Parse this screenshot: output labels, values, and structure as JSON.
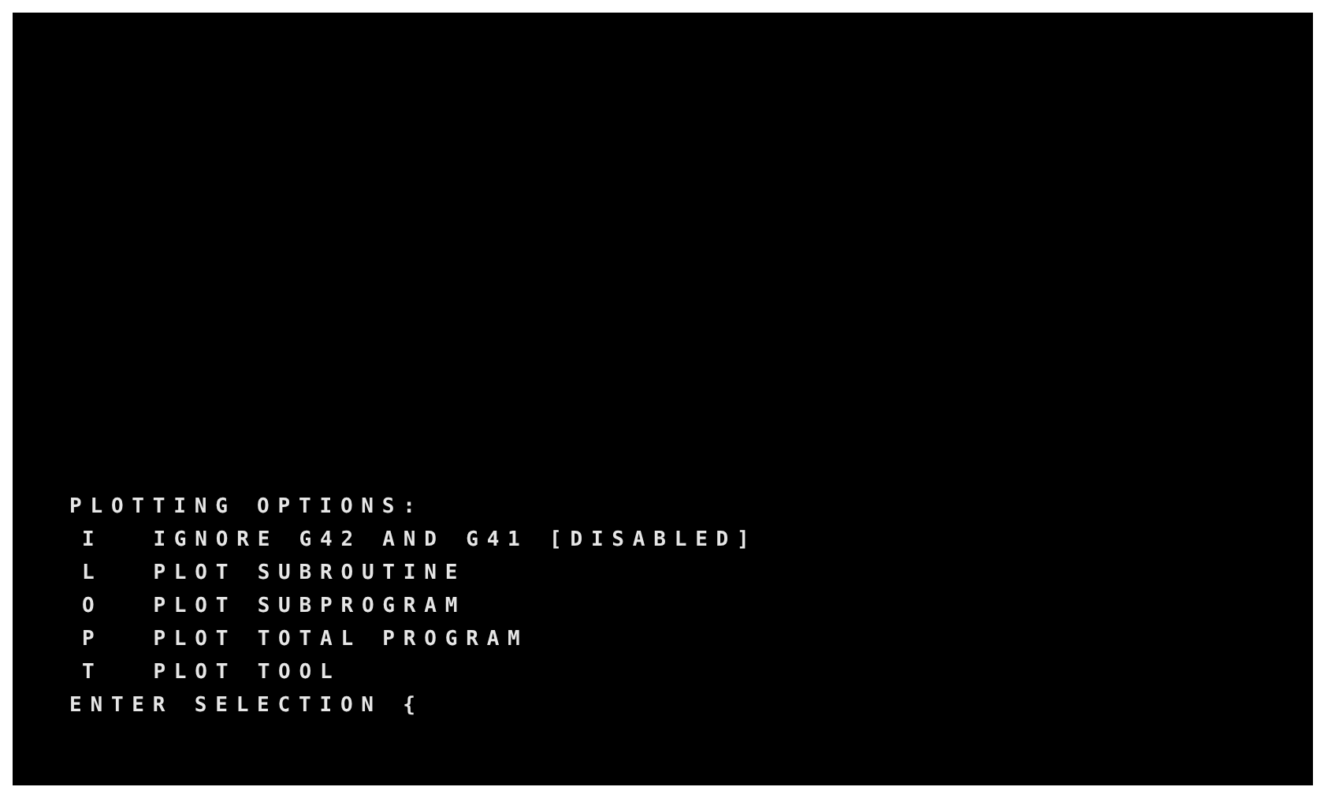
{
  "heading": "PLOTTING OPTIONS:",
  "options": [
    {
      "key": "I",
      "label": "IGNORE G42 AND G41 [DISABLED]"
    },
    {
      "key": "L",
      "label": "PLOT SUBROUTINE"
    },
    {
      "key": "O",
      "label": "PLOT SUBPROGRAM"
    },
    {
      "key": "P",
      "label": "PLOT TOTAL PROGRAM"
    },
    {
      "key": "T",
      "label": "PLOT TOOL"
    }
  ],
  "prompt": "ENTER SELECTION {"
}
